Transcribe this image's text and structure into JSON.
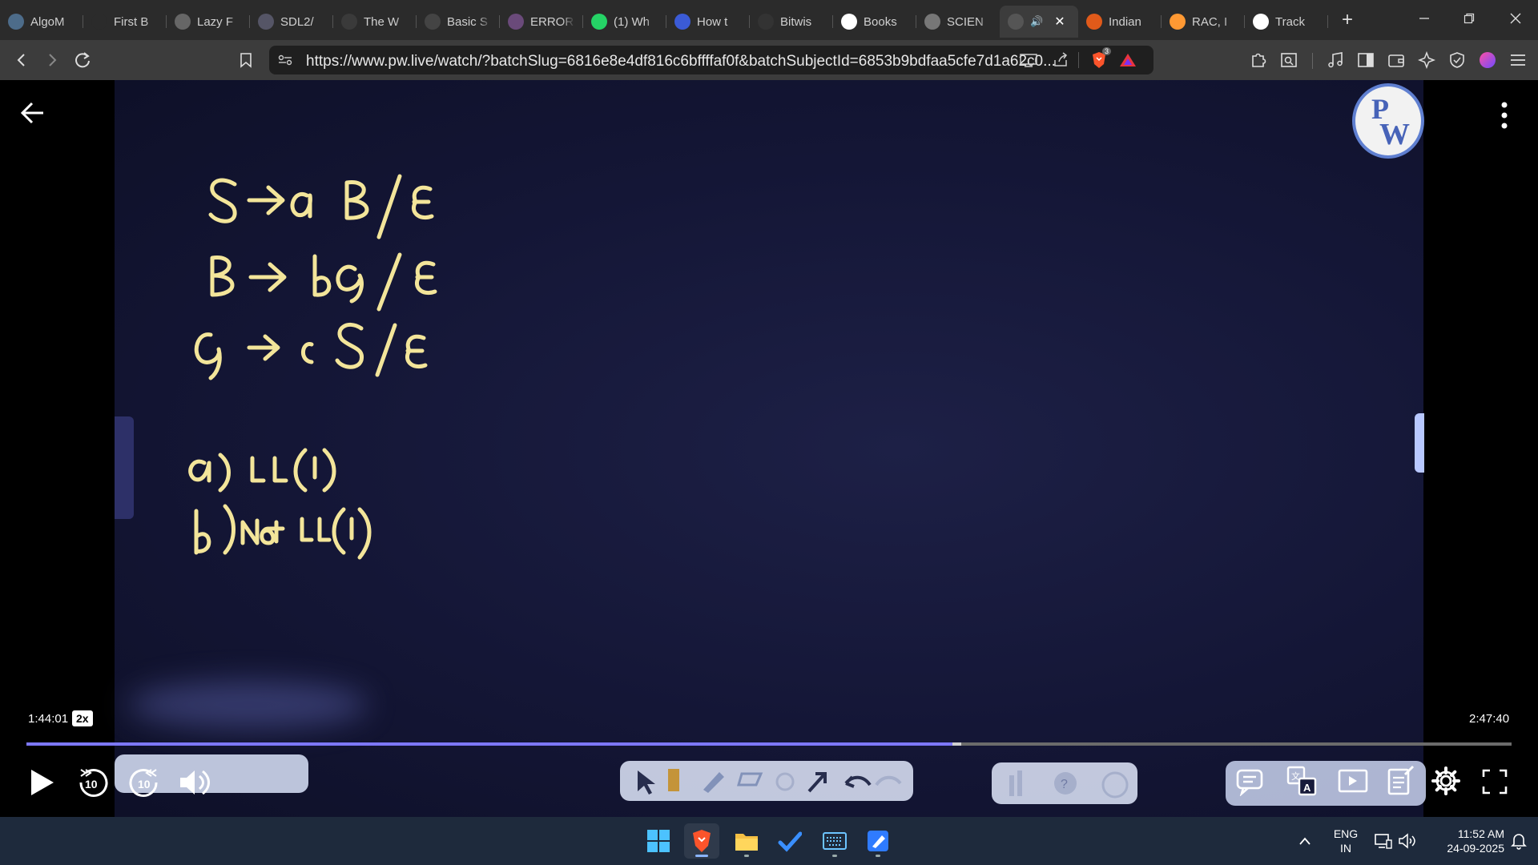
{
  "browser": {
    "tabs": [
      {
        "title": "AlgoM",
        "icon": "algomaster-icon",
        "color": "#4d6c8a"
      },
      {
        "title": "First B",
        "icon": "lightning-icon",
        "color": "#2b2b2b"
      },
      {
        "title": "Lazy F",
        "icon": "circle-logo-icon",
        "color": "#666"
      },
      {
        "title": "SDL2/",
        "icon": "sdl-icon",
        "color": "#556"
      },
      {
        "title": "The W",
        "icon": "wordpress-icon",
        "color": "#3a3a3a"
      },
      {
        "title": "Basic S",
        "icon": "md-icon",
        "color": "#444"
      },
      {
        "title": "ERROR",
        "icon": "error-globe-icon",
        "color": "#6a4a7a"
      },
      {
        "title": "(1) Wh",
        "icon": "whatsapp-icon",
        "color": "#25d366"
      },
      {
        "title": "How t",
        "icon": "copilot-icon",
        "color": "#3b5bd6"
      },
      {
        "title": "Bitwis",
        "icon": "otg-icon",
        "color": "#333"
      },
      {
        "title": "Books",
        "icon": "google-icon",
        "color": "#fff"
      },
      {
        "title": "SCIEN",
        "icon": "globe-icon",
        "color": "#777"
      },
      {
        "title": "",
        "icon": "pw-tab-icon",
        "color": "#555",
        "active": true
      },
      {
        "title": "Indian",
        "icon": "indian-oil-icon",
        "color": "#e05a1a"
      },
      {
        "title": "RAC, I",
        "icon": "india-flag-icon",
        "color": "#ff9933"
      },
      {
        "title": "Track",
        "icon": "amazon-icon",
        "color": "#fff"
      }
    ],
    "new_tab": "+",
    "url": "https://www.pw.live/watch/?batchSlug=6816e8e4df816c6bffffaf0f&batchSubjectId=6853b9bdfaa5cfe7d1a62c0...",
    "shield_count": "3"
  },
  "player": {
    "current_time": "1:44:01",
    "speed": "2x",
    "total_time": "2:47:40",
    "progress": 0.6235,
    "buffered": 0.6295,
    "rewind_label": "10",
    "forward_label": "10"
  },
  "board": {
    "lines": [
      "S → a B / ε",
      "B → b C / ε",
      "C → c S / ε",
      "a) LL(1)",
      "b) Not LL(1)"
    ]
  },
  "taskbar": {
    "lang": "ENG",
    "region": "IN",
    "time": "11:52 AM",
    "date": "24-09-2025"
  },
  "colors": {
    "board": "#171a3a",
    "chalk": "#f3e59a",
    "accent": "#7d78ff"
  }
}
